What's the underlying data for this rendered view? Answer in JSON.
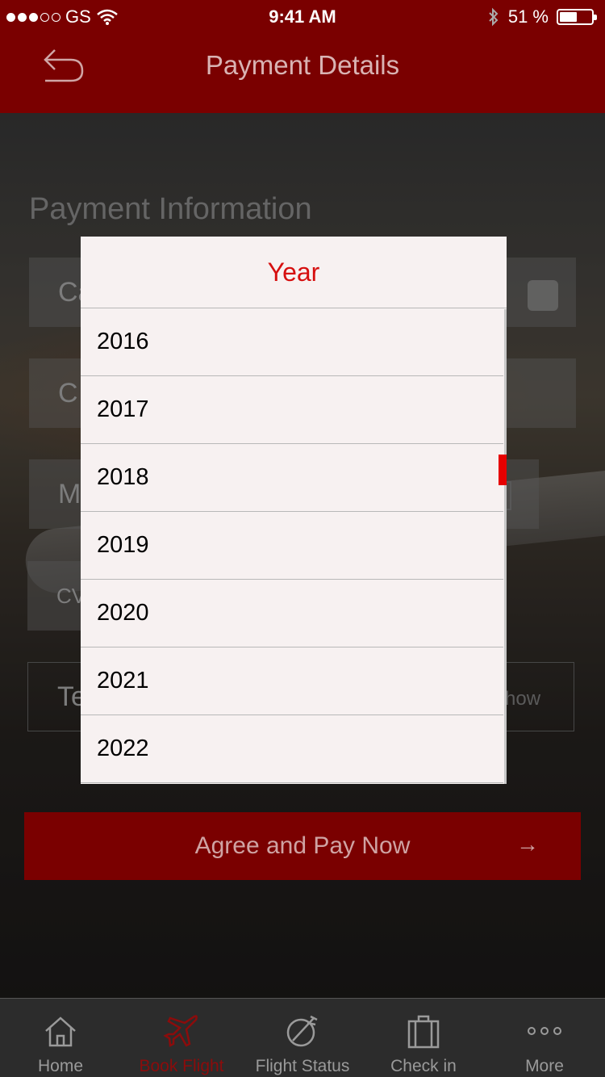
{
  "status_bar": {
    "carrier": "GS",
    "time": "9:41 AM",
    "battery": "51 %",
    "battery_level": 0.51
  },
  "nav": {
    "title": "Payment Details"
  },
  "form": {
    "section_title": "Payment Information",
    "card_number_placeholder": "Ca",
    "cardholder_placeholder": "C",
    "month_placeholder": "M",
    "cvv_placeholder": "CV",
    "terms_placeholder": "Te",
    "show_label": "how"
  },
  "pay_button": {
    "label": "Agree and Pay Now",
    "arrow": "→"
  },
  "picker": {
    "title": "Year",
    "years": [
      "2016",
      "2017",
      "2018",
      "2019",
      "2020",
      "2021",
      "2022"
    ],
    "accent": "#d60f0f"
  },
  "tabs": [
    {
      "label": "Home",
      "icon": "home-icon",
      "active": false
    },
    {
      "label": "Book Flight",
      "icon": "airplane-icon",
      "active": true
    },
    {
      "label": "Flight Status",
      "icon": "flight-status-icon",
      "active": false
    },
    {
      "label": "Check in",
      "icon": "suitcase-icon",
      "active": false
    },
    {
      "label": "More",
      "icon": "more-icon",
      "active": false
    }
  ],
  "colors": {
    "brand": "#7a0000",
    "active_tab": "#8b0c0c"
  }
}
